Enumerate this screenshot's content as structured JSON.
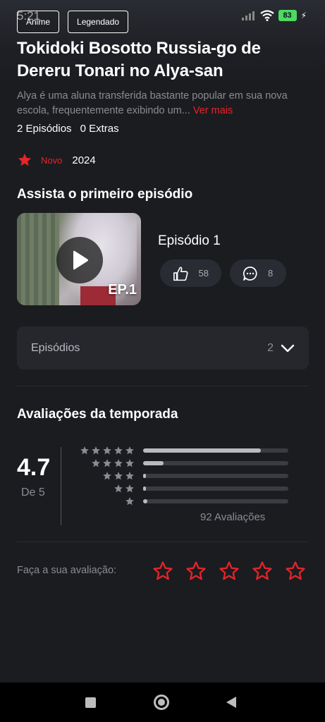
{
  "status_bar": {
    "time": "5:21",
    "battery": "83"
  },
  "chips": [
    "Anime",
    "Legendado"
  ],
  "title": "Tokidoki Bosotto Russia-go de Dereru Tonari no Alya-san",
  "synopsis": {
    "text": "Alya é uma aluna transferida bastante popular em sua nova escola, frequentemente exibindo um...",
    "more_link": "Ver mais"
  },
  "counts": {
    "episodes": "2 Episódios",
    "extras": "0 Extras"
  },
  "meta": {
    "badge": "Novo",
    "year": "2024"
  },
  "first_episode": {
    "section_title": "Assista o primeiro episódio",
    "thumb_tag": "EP.1",
    "title": "Episódio 1",
    "likes": "58",
    "comments": "8"
  },
  "episodes_accordion": {
    "label": "Episódios",
    "count": "2"
  },
  "ratings": {
    "section_title": "Avaliações da temporada",
    "score": "4.7",
    "scale": "De 5",
    "distribution": [
      {
        "stars": 5,
        "fraction": 0.81
      },
      {
        "stars": 4,
        "fraction": 0.14
      },
      {
        "stars": 3,
        "fraction": 0.02
      },
      {
        "stars": 2,
        "fraction": 0.02
      },
      {
        "stars": 1,
        "fraction": 0.03
      }
    ],
    "reviews_count": "92 Avaliações"
  },
  "rate_yourself": {
    "label": "Faça a sua avaliação:"
  },
  "colors": {
    "accent": "#e5252a",
    "background": "#1b1c20",
    "card": "#25272d"
  }
}
